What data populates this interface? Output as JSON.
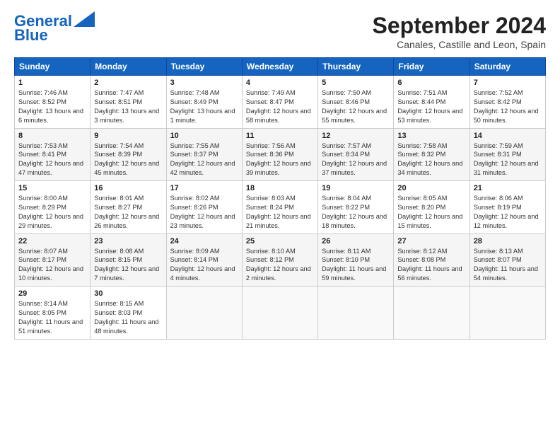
{
  "logo": {
    "line1": "General",
    "line2": "Blue"
  },
  "title": "September 2024",
  "location": "Canales, Castille and Leon, Spain",
  "weekdays": [
    "Sunday",
    "Monday",
    "Tuesday",
    "Wednesday",
    "Thursday",
    "Friday",
    "Saturday"
  ],
  "weeks": [
    [
      {
        "day": "1",
        "rise": "Sunrise: 7:46 AM",
        "set": "Sunset: 8:52 PM",
        "daylight": "Daylight: 13 hours and 6 minutes."
      },
      {
        "day": "2",
        "rise": "Sunrise: 7:47 AM",
        "set": "Sunset: 8:51 PM",
        "daylight": "Daylight: 13 hours and 3 minutes."
      },
      {
        "day": "3",
        "rise": "Sunrise: 7:48 AM",
        "set": "Sunset: 8:49 PM",
        "daylight": "Daylight: 13 hours and 1 minute."
      },
      {
        "day": "4",
        "rise": "Sunrise: 7:49 AM",
        "set": "Sunset: 8:47 PM",
        "daylight": "Daylight: 12 hours and 58 minutes."
      },
      {
        "day": "5",
        "rise": "Sunrise: 7:50 AM",
        "set": "Sunset: 8:46 PM",
        "daylight": "Daylight: 12 hours and 55 minutes."
      },
      {
        "day": "6",
        "rise": "Sunrise: 7:51 AM",
        "set": "Sunset: 8:44 PM",
        "daylight": "Daylight: 12 hours and 53 minutes."
      },
      {
        "day": "7",
        "rise": "Sunrise: 7:52 AM",
        "set": "Sunset: 8:42 PM",
        "daylight": "Daylight: 12 hours and 50 minutes."
      }
    ],
    [
      {
        "day": "8",
        "rise": "Sunrise: 7:53 AM",
        "set": "Sunset: 8:41 PM",
        "daylight": "Daylight: 12 hours and 47 minutes."
      },
      {
        "day": "9",
        "rise": "Sunrise: 7:54 AM",
        "set": "Sunset: 8:39 PM",
        "daylight": "Daylight: 12 hours and 45 minutes."
      },
      {
        "day": "10",
        "rise": "Sunrise: 7:55 AM",
        "set": "Sunset: 8:37 PM",
        "daylight": "Daylight: 12 hours and 42 minutes."
      },
      {
        "day": "11",
        "rise": "Sunrise: 7:56 AM",
        "set": "Sunset: 8:36 PM",
        "daylight": "Daylight: 12 hours and 39 minutes."
      },
      {
        "day": "12",
        "rise": "Sunrise: 7:57 AM",
        "set": "Sunset: 8:34 PM",
        "daylight": "Daylight: 12 hours and 37 minutes."
      },
      {
        "day": "13",
        "rise": "Sunrise: 7:58 AM",
        "set": "Sunset: 8:32 PM",
        "daylight": "Daylight: 12 hours and 34 minutes."
      },
      {
        "day": "14",
        "rise": "Sunrise: 7:59 AM",
        "set": "Sunset: 8:31 PM",
        "daylight": "Daylight: 12 hours and 31 minutes."
      }
    ],
    [
      {
        "day": "15",
        "rise": "Sunrise: 8:00 AM",
        "set": "Sunset: 8:29 PM",
        "daylight": "Daylight: 12 hours and 29 minutes."
      },
      {
        "day": "16",
        "rise": "Sunrise: 8:01 AM",
        "set": "Sunset: 8:27 PM",
        "daylight": "Daylight: 12 hours and 26 minutes."
      },
      {
        "day": "17",
        "rise": "Sunrise: 8:02 AM",
        "set": "Sunset: 8:26 PM",
        "daylight": "Daylight: 12 hours and 23 minutes."
      },
      {
        "day": "18",
        "rise": "Sunrise: 8:03 AM",
        "set": "Sunset: 8:24 PM",
        "daylight": "Daylight: 12 hours and 21 minutes."
      },
      {
        "day": "19",
        "rise": "Sunrise: 8:04 AM",
        "set": "Sunset: 8:22 PM",
        "daylight": "Daylight: 12 hours and 18 minutes."
      },
      {
        "day": "20",
        "rise": "Sunrise: 8:05 AM",
        "set": "Sunset: 8:20 PM",
        "daylight": "Daylight: 12 hours and 15 minutes."
      },
      {
        "day": "21",
        "rise": "Sunrise: 8:06 AM",
        "set": "Sunset: 8:19 PM",
        "daylight": "Daylight: 12 hours and 12 minutes."
      }
    ],
    [
      {
        "day": "22",
        "rise": "Sunrise: 8:07 AM",
        "set": "Sunset: 8:17 PM",
        "daylight": "Daylight: 12 hours and 10 minutes."
      },
      {
        "day": "23",
        "rise": "Sunrise: 8:08 AM",
        "set": "Sunset: 8:15 PM",
        "daylight": "Daylight: 12 hours and 7 minutes."
      },
      {
        "day": "24",
        "rise": "Sunrise: 8:09 AM",
        "set": "Sunset: 8:14 PM",
        "daylight": "Daylight: 12 hours and 4 minutes."
      },
      {
        "day": "25",
        "rise": "Sunrise: 8:10 AM",
        "set": "Sunset: 8:12 PM",
        "daylight": "Daylight: 12 hours and 2 minutes."
      },
      {
        "day": "26",
        "rise": "Sunrise: 8:11 AM",
        "set": "Sunset: 8:10 PM",
        "daylight": "Daylight: 11 hours and 59 minutes."
      },
      {
        "day": "27",
        "rise": "Sunrise: 8:12 AM",
        "set": "Sunset: 8:08 PM",
        "daylight": "Daylight: 11 hours and 56 minutes."
      },
      {
        "day": "28",
        "rise": "Sunrise: 8:13 AM",
        "set": "Sunset: 8:07 PM",
        "daylight": "Daylight: 11 hours and 54 minutes."
      }
    ],
    [
      {
        "day": "29",
        "rise": "Sunrise: 8:14 AM",
        "set": "Sunset: 8:05 PM",
        "daylight": "Daylight: 11 hours and 51 minutes."
      },
      {
        "day": "30",
        "rise": "Sunrise: 8:15 AM",
        "set": "Sunset: 8:03 PM",
        "daylight": "Daylight: 11 hours and 48 minutes."
      },
      null,
      null,
      null,
      null,
      null
    ]
  ]
}
